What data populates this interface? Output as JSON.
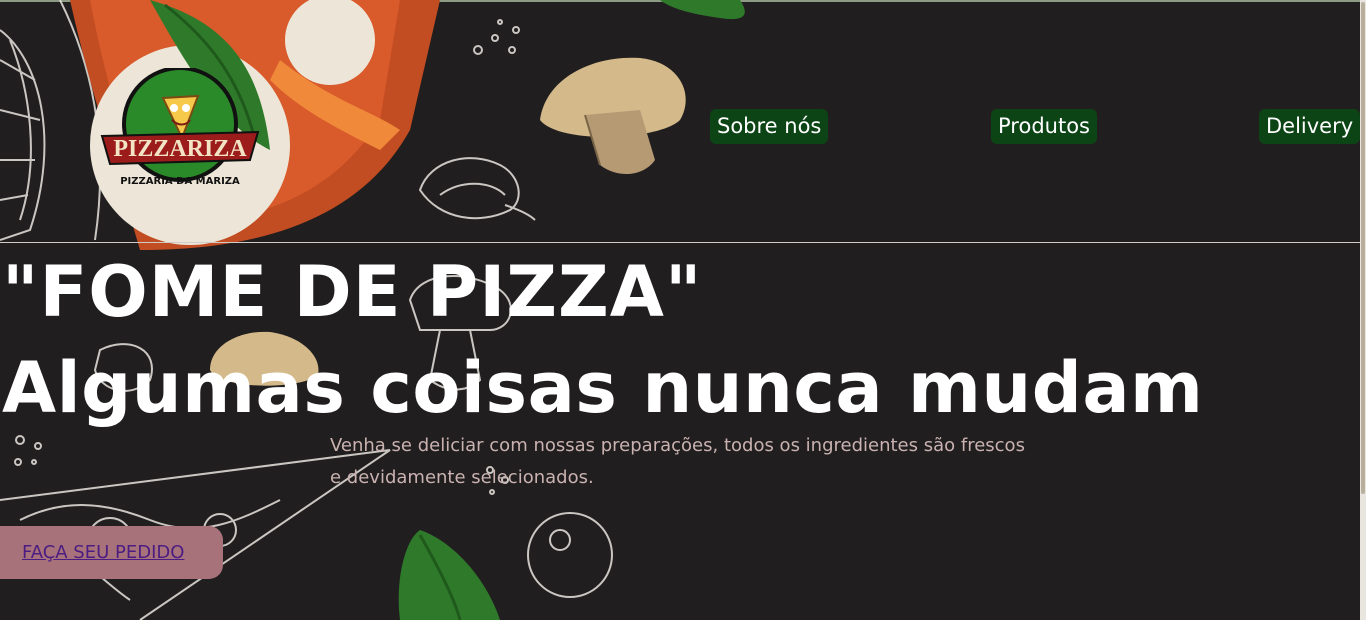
{
  "brand": {
    "logo_name": "PIZZARIZA",
    "logo_tagline": "PIZZARIA DA MARIZA"
  },
  "nav": {
    "items": [
      {
        "label": "Sobre nós"
      },
      {
        "label": "Produtos"
      },
      {
        "label": "Delivery"
      }
    ]
  },
  "hero": {
    "headline_line1": "\"FOME DE PIZZA\"",
    "headline_line2": "Algumas coisas nunca mudam",
    "description": "Venha se deliciar com nossas preparações, todos os ingredientes são frescos e devidamente selecionados.",
    "cta_label": "FAÇA SEU PEDIDO"
  },
  "colors": {
    "background": "#211e1f",
    "nav_button": "#0d4416",
    "cta_button": "#a8727a",
    "cta_text": "#4b1d82",
    "description_text": "#c9b2b0"
  }
}
